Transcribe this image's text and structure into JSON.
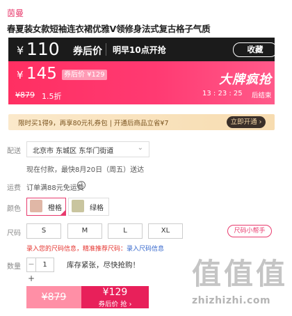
{
  "brand": "茵曼",
  "title": "春夏装女款短袖连衣裙优雅V领修身法式复古格子气质",
  "presale": {
    "yen": "¥",
    "price": "110",
    "price_label": "券后价",
    "start_text": "明早10点开抢",
    "collect_label": "收藏"
  },
  "promo": {
    "yen": "¥",
    "price": "145",
    "coupon_tag": "券后价 ¥129",
    "original_price": "¥879",
    "discount": "1.5折",
    "event_title": "大牌疯抢",
    "countdown": "13 : 23 : 25",
    "countdown_suffix": "后结束"
  },
  "vip": {
    "text": "限时买1得9，再享80元礼券包 | 开通后商品立省¥7",
    "button": "立即开通 ›"
  },
  "delivery": {
    "label": "配送",
    "address": "北京市 东城区 东华门街道",
    "chevron": "⌄",
    "note": "现在付款，最快8月20日（周五）送达"
  },
  "freight": {
    "label": "运费",
    "text": "订单满88元免运费",
    "help": "?"
  },
  "color": {
    "label": "颜色",
    "options": [
      {
        "name": "橙格",
        "swatch": "#e0b7a6"
      },
      {
        "name": "绿格",
        "swatch": "#c9c59f"
      }
    ]
  },
  "size": {
    "label": "尺码",
    "options": [
      "S",
      "M",
      "L",
      "XL"
    ],
    "helper": "尺码小帮手",
    "hint": "录入您的尺码信息，精准推荐尺码：",
    "hint_link": "录入尺码信息"
  },
  "quantity": {
    "label": "数量",
    "minus": "−",
    "value": "1",
    "plus": "+",
    "stock_text": "库存紧张，尽快抢购！"
  },
  "buy": {
    "original": "¥879",
    "price": "¥129",
    "sub": "券后价 抢 ›"
  },
  "watermark": {
    "chars": "值值值",
    "site": "zhizhizhi.com"
  }
}
